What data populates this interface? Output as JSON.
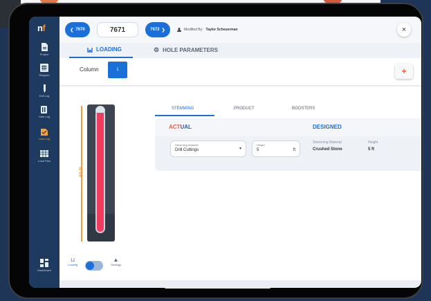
{
  "app": {
    "logo_n": "n",
    "logo_f": "f"
  },
  "sidebar": {
    "items": [
      {
        "label": "Project",
        "icon": "document-icon"
      },
      {
        "label": "Diagram",
        "icon": "grid-icon"
      },
      {
        "label": "Drill Log",
        "icon": "drill-icon"
      },
      {
        "label": "Hole Log",
        "icon": "hole-log-icon"
      },
      {
        "label": "Load Log",
        "icon": "load-log-icon",
        "active": true
      },
      {
        "label": "Load Plan",
        "icon": "table-icon"
      }
    ],
    "bottom": {
      "label": "Dashboard",
      "icon": "dashboard-icon"
    }
  },
  "header": {
    "prev_label": "7670",
    "current_hole": "7671",
    "next_label": "7672",
    "modified_prefix": "Modified By:",
    "modified_by": "Taylor Scheuerman",
    "close_label": "×"
  },
  "tabs": [
    {
      "label": "LOADING",
      "active": true
    },
    {
      "label": "HOLE PARAMETERS",
      "active": false
    }
  ],
  "column": {
    "label": "Column",
    "value": "1",
    "add_label": "+"
  },
  "hole": {
    "depth_label": "50 ft",
    "toggle_left": "Loading",
    "toggle_right": "Geology"
  },
  "sub_tabs": [
    "STEMMING",
    "PRODUCT",
    "BOOSTERS"
  ],
  "stemming": {
    "actual_prefix": "ACT",
    "actual_suffix": "UAL",
    "designed_title": "DESIGNED",
    "material_label": "Stemming Material",
    "material_value": "Drill Cuttings",
    "height_label": "Height",
    "height_value": "5",
    "height_unit": "ft",
    "designed_material_label": "Stemming Material",
    "designed_material_value": "Crushed Stone",
    "designed_height_label": "Height",
    "designed_height_value": "5 ft"
  },
  "colors": {
    "accent": "#1a6fd8",
    "charge": "#f03c5f",
    "orange": "#f29a3a",
    "actual": "#e85c4a",
    "sidebar": "#1f3a5f"
  }
}
